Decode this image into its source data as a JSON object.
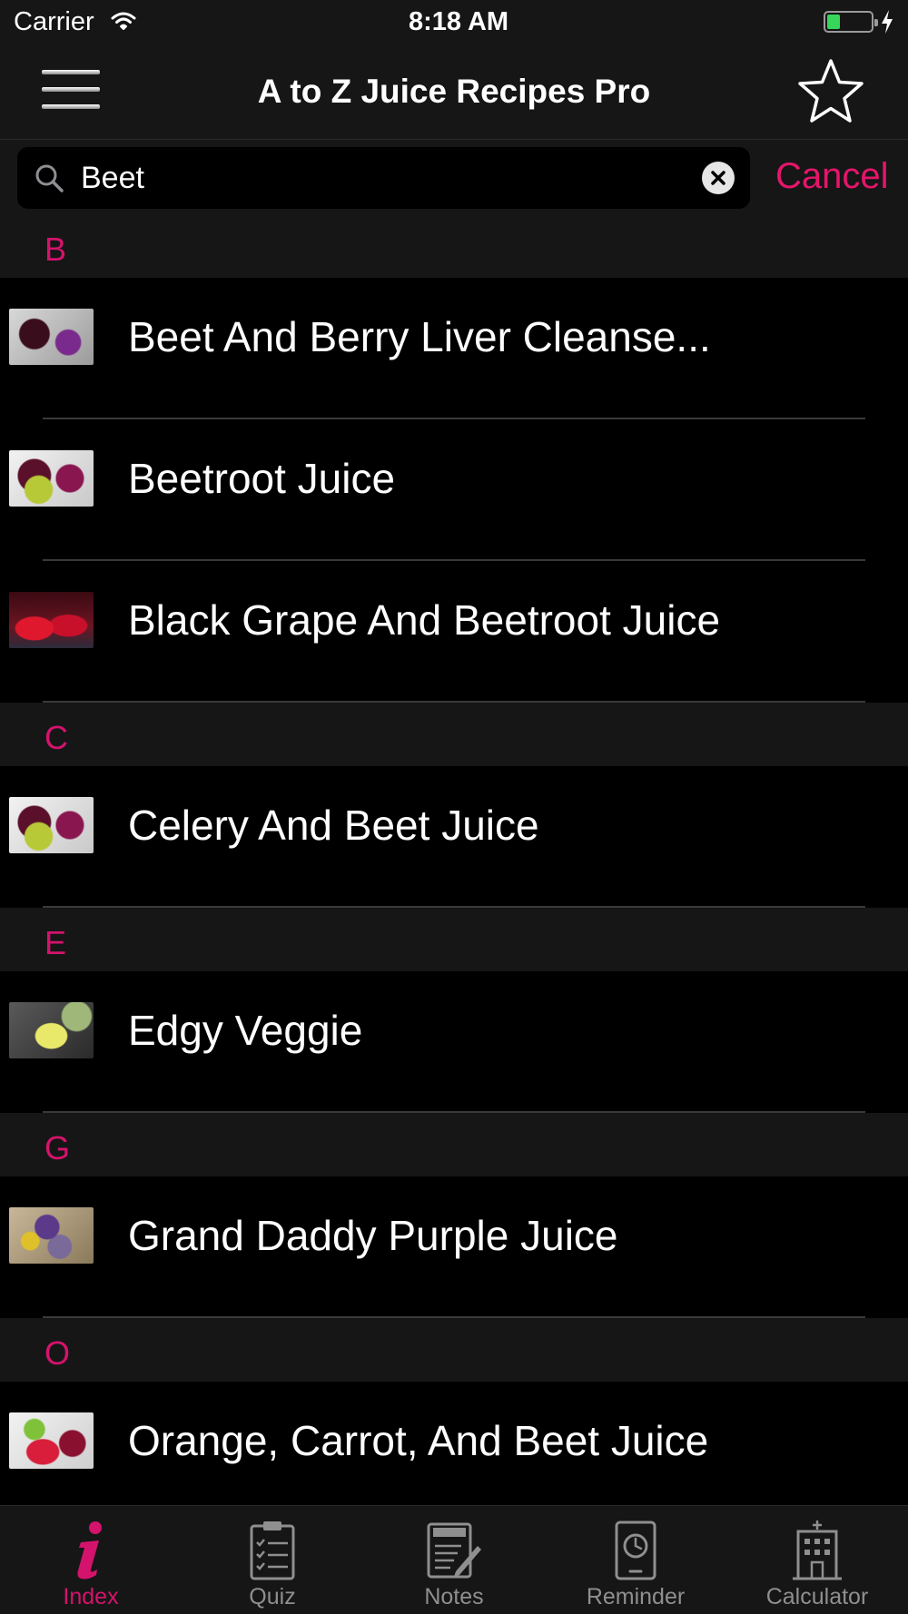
{
  "status_bar": {
    "carrier": "Carrier",
    "time": "8:18 AM",
    "battery_level": 0.3
  },
  "nav": {
    "title": "A to Z Juice Recipes Pro",
    "left_icon": "hamburger-menu-icon",
    "right_icon": "star-icon"
  },
  "search": {
    "value": "Beet",
    "cancel_label": "Cancel"
  },
  "sections": [
    {
      "letter": "B",
      "items": [
        {
          "label": "Beet And Berry Liver Cleanse..."
        },
        {
          "label": "Beetroot Juice"
        },
        {
          "label": "Black Grape And Beetroot Juice"
        }
      ]
    },
    {
      "letter": "C",
      "items": [
        {
          "label": "Celery And Beet Juice"
        }
      ]
    },
    {
      "letter": "E",
      "items": [
        {
          "label": "Edgy Veggie"
        }
      ]
    },
    {
      "letter": "G",
      "items": [
        {
          "label": "Grand Daddy Purple Juice"
        }
      ]
    },
    {
      "letter": "O",
      "items": [
        {
          "label": "Orange, Carrot, And Beet Juice"
        }
      ]
    }
  ],
  "tabs": [
    {
      "label": "Index",
      "icon": "info-icon",
      "active": true
    },
    {
      "label": "Quiz",
      "icon": "clipboard-checklist-icon",
      "active": false
    },
    {
      "label": "Notes",
      "icon": "notes-pencil-icon",
      "active": false
    },
    {
      "label": "Reminder",
      "icon": "clock-device-icon",
      "active": false
    },
    {
      "label": "Calculator",
      "icon": "building-icon",
      "active": false
    }
  ],
  "colors": {
    "accent": "#d4136c",
    "cancel": "#e5156b",
    "bar_background": "#161616",
    "list_background": "#000000",
    "inactive_tab": "#8f8f8f"
  }
}
